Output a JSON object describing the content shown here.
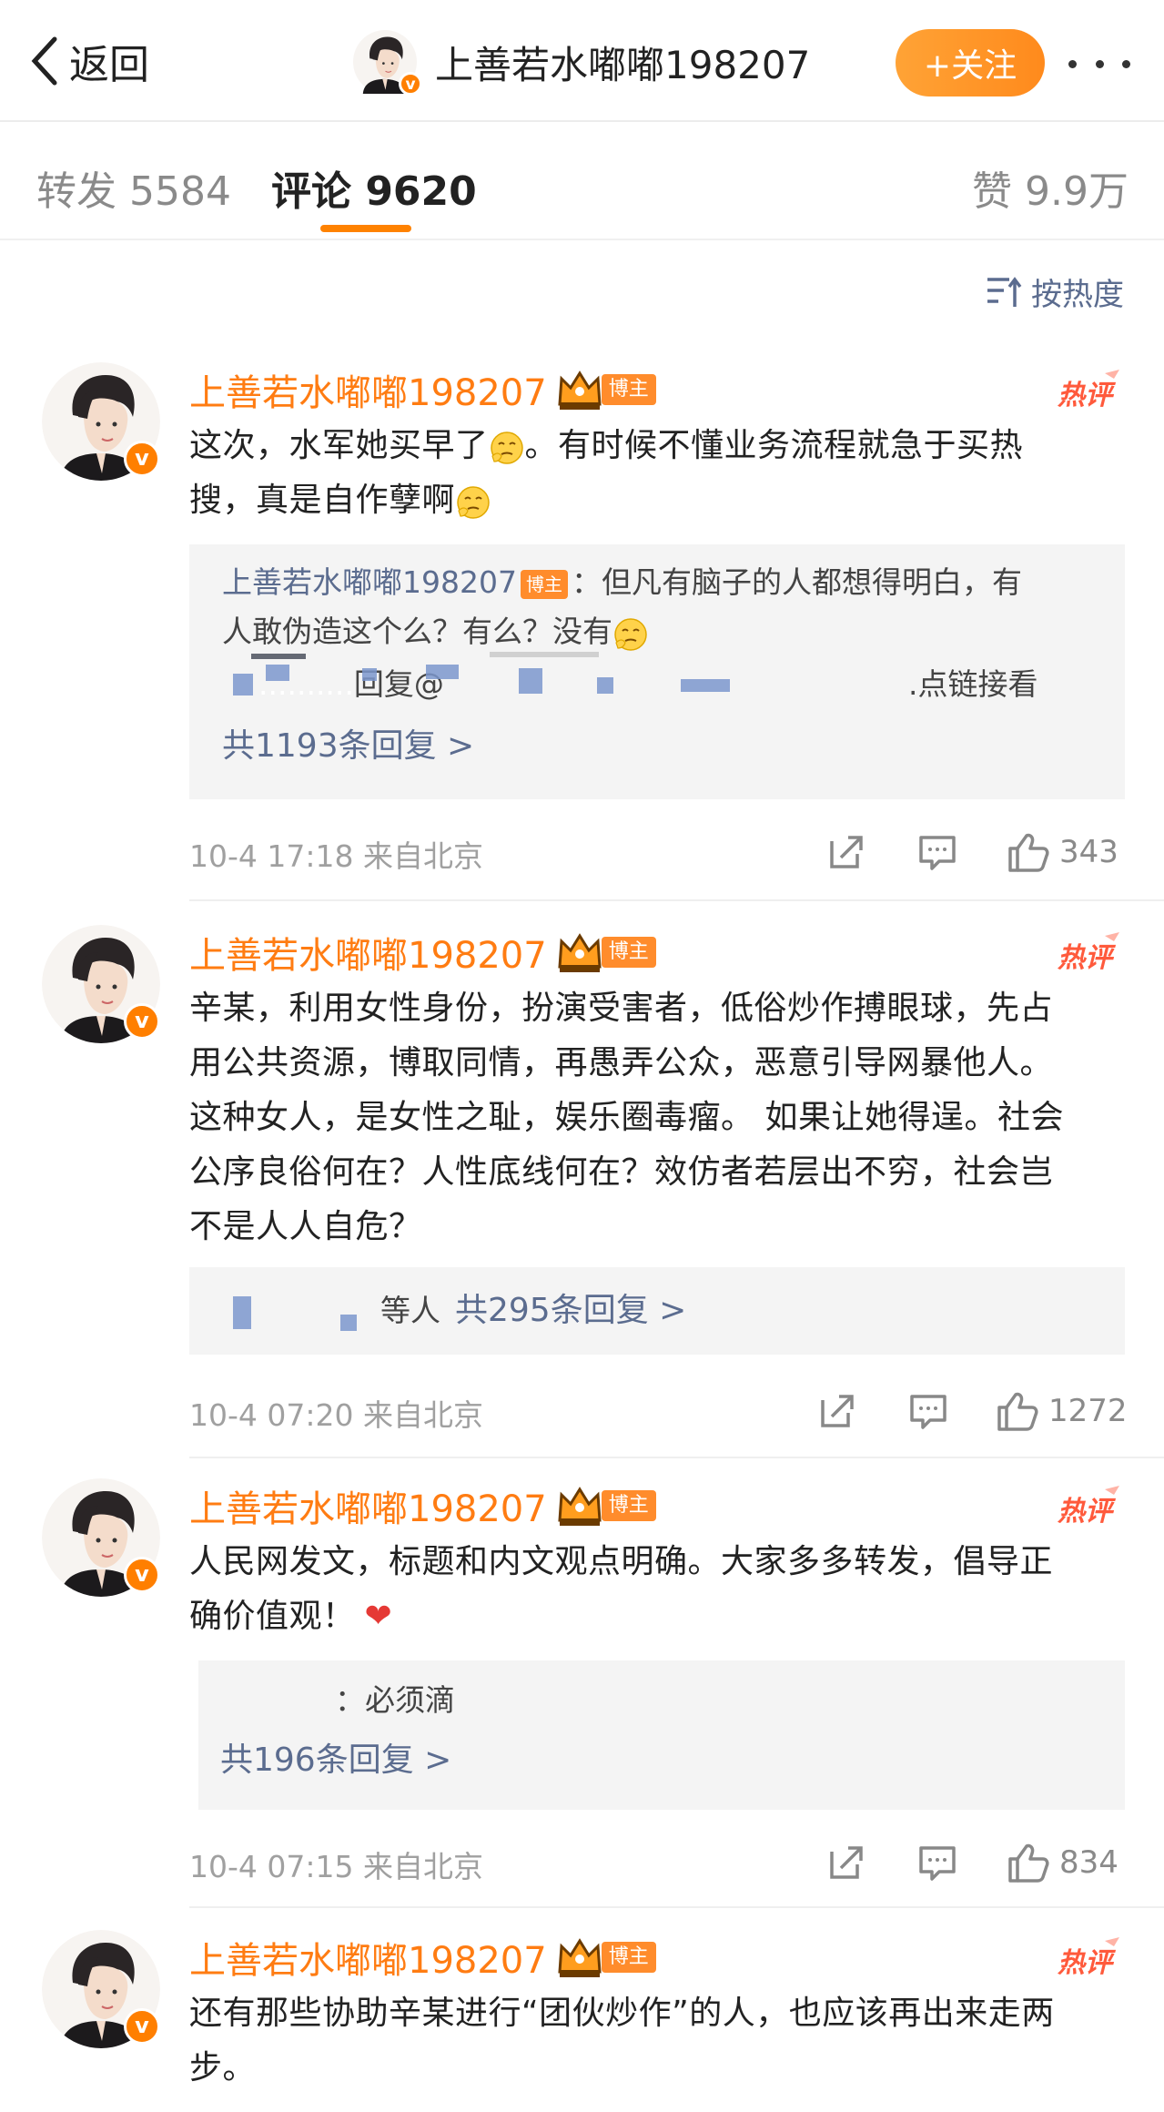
{
  "header": {
    "back_label": "返回",
    "title": "上善若水嘟嘟198207",
    "follow_label": "+关注"
  },
  "tabs": [
    {
      "label": "转发 5584",
      "active": false
    },
    {
      "label": "评论 9620",
      "active": true
    },
    {
      "label": "赞 9.9万",
      "active": false
    }
  ],
  "sort_label": "按热度",
  "badge_label": "博主",
  "hot_label": "热评",
  "colors": {
    "accent": "#ff8200",
    "name": "#ff7c12",
    "link": "#5b6c8f",
    "follow_bg": "#ff9626"
  },
  "comments": [
    {
      "author": "上善若水嘟嘟198207",
      "text_a": "这次，水军她买早了",
      "text_b": "。有时候不懂业务流程就急于买热",
      "text_c": "搜，真是自作孽啊",
      "reply1_author": "上善若水嘟嘟198207",
      "reply1_text_a": "：但凡有脑子的人都想得明白，有",
      "reply1_text_b": "人敢伪造这个么？有么？没有",
      "reply2_prefix": "回复@",
      "reply2_suffix": ".点链接看",
      "reply_count": "共1193条回复 >",
      "time": "10-4 17:18  来自北京",
      "likes": "343"
    },
    {
      "author": "上善若水嘟嘟198207",
      "lines": [
        "辛某，利用女性身份，扮演受害者，低俗炒作搏眼球，先占",
        "用公共资源，博取同情，再愚弄公众，恶意引导网暴他人。",
        "这种女人，是女性之耻，娱乐圈毒瘤。  如果让她得逞。社会",
        "公序良俗何在？人性底线何在？效仿者若层出不穷，社会岂",
        "不是人人自危？"
      ],
      "reply_prefix": "等人",
      "reply_count": "共295条回复 >",
      "time": "10-4 07:20  来自北京",
      "likes": "1272"
    },
    {
      "author": "上善若水嘟嘟198207",
      "line1": "人民网发文，标题和内文观点明确。大家多多转发，倡导正",
      "line2": "确价值观！",
      "reply_text": "：必须滴",
      "reply_count": "共196条回复 >",
      "time": "10-4 07:15  来自北京",
      "likes": "834"
    },
    {
      "author": "上善若水嘟嘟198207",
      "line1": "还有那些协助辛某进行“团伙炒作”的人，也应该再出来走两",
      "line2": "步。"
    }
  ]
}
